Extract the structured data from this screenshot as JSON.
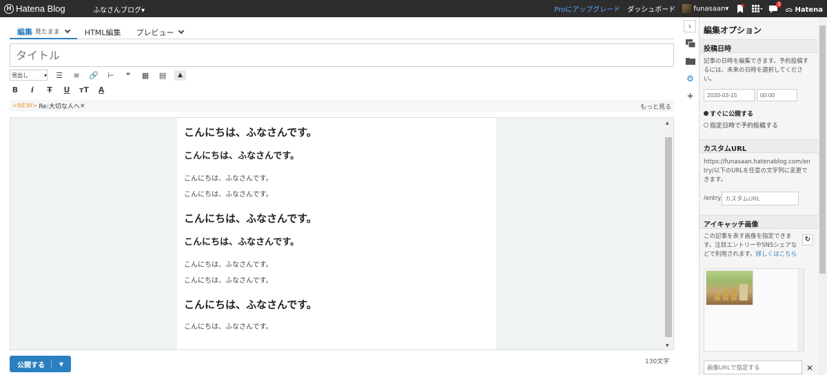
{
  "topbar": {
    "logo_text": "Hatena Blog",
    "logo_mark": "H",
    "blog_name": "ふなさんブログ▾",
    "pro_link": "Proにアップグレード",
    "dashboard": "ダッシュボード",
    "username": "funasaan▾",
    "notification_count": "3",
    "hatena": "Hatena"
  },
  "editor": {
    "tabs": [
      {
        "label": "編集",
        "sub": "見たまま"
      },
      {
        "label": "HTML編集"
      },
      {
        "label": "プレビュー"
      }
    ],
    "title_placeholder": "タイトル",
    "heading_select": "見出し",
    "new_tag": "<NEW>",
    "new_entry": "Re:大切な人へ",
    "close_mark": "×",
    "more": "もっと見る",
    "content": {
      "h1": "こんにちは、ふなさんです。",
      "h2": "こんにちは、ふなさんです。",
      "p": "こんにちは、ふなさんです。"
    },
    "publish_label": "公開する",
    "char_count": "130文字"
  },
  "panel": {
    "title": "編集オプション",
    "date_section": "投稿日時",
    "date_help": "記事の日時を編集できます。予約投稿するには、未来の日時を選択してください。",
    "date_value": "2020-03-15",
    "time_value": "00:00",
    "radio_now": "すぐに公開する",
    "radio_schedule": "指定日時で予約投稿する",
    "url_section": "カスタムURL",
    "url_help": "https://funasaan.hatenablog.com/entry/以下のURLを任意の文字列に変更できます。",
    "url_prefix": "/entry/",
    "url_placeholder": "カスタムURL",
    "eyecatch_section": "アイキャッチ画像",
    "eyecatch_help": "この記事を表す画像を指定できます。注目エントリーやSNSシェアなどで利用されます。",
    "eyecatch_link": "詳しくはこちら",
    "image_url_placeholder": "画像URLで指定する",
    "clear_mark": "✕"
  }
}
